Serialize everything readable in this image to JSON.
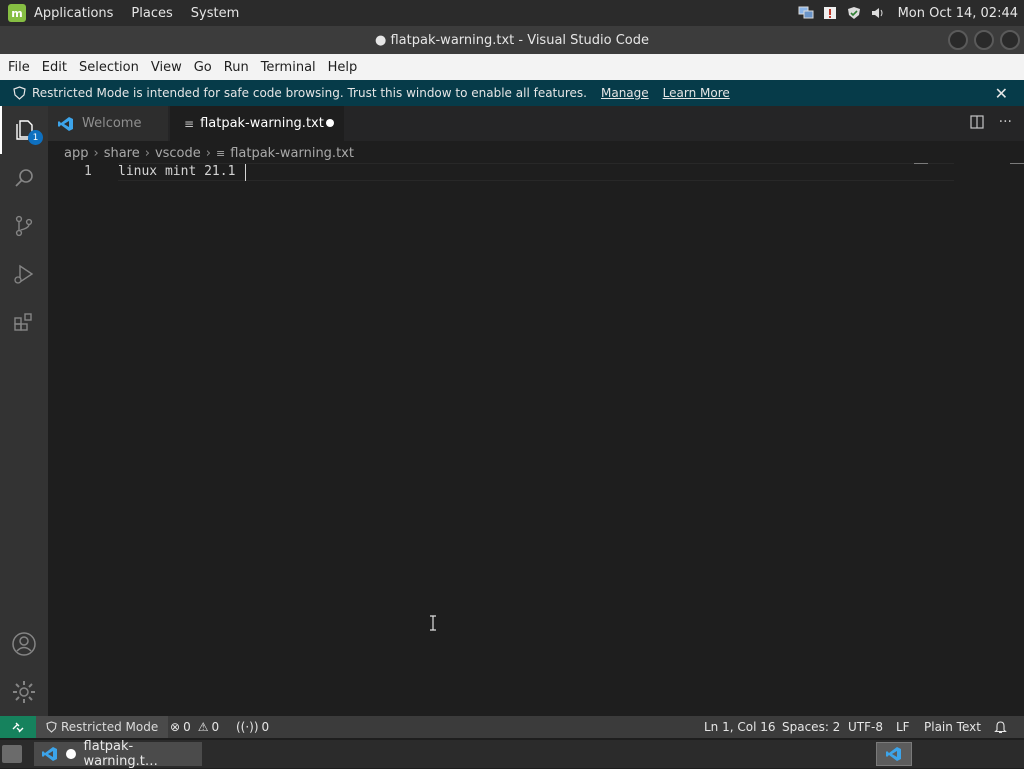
{
  "system_panel": {
    "menus": [
      "Applications",
      "Places",
      "System"
    ],
    "clock": "Mon Oct 14, 02:44",
    "tray_icons": [
      "network-icon",
      "update-icon",
      "shield-icon",
      "volume-icon"
    ]
  },
  "window": {
    "title": "● flatpak-warning.txt - Visual Studio Code"
  },
  "menubar": {
    "items": [
      "File",
      "Edit",
      "Selection",
      "View",
      "Go",
      "Run",
      "Terminal",
      "Help"
    ]
  },
  "banner": {
    "message": "Restricted Mode is intended for safe code browsing. Trust this window to enable all features.",
    "manage_label": "Manage",
    "learn_more_label": "Learn More"
  },
  "activity_bar": {
    "explorer_badge": "1"
  },
  "tabs": [
    {
      "label": "Welcome"
    },
    {
      "label": "flatpak-warning.txt"
    }
  ],
  "breadcrumbs": [
    "app",
    "share",
    "vscode",
    "flatpak-warning.txt"
  ],
  "editor": {
    "line_number": "1",
    "line_text": "linux mint 21.1"
  },
  "statusbar": {
    "restricted_label": "Restricted Mode",
    "errors": "0",
    "warnings": "0",
    "ports": "0",
    "position": "Ln 1, Col 16",
    "spaces": "Spaces: 2",
    "encoding": "UTF-8",
    "eol": "LF",
    "language": "Plain Text"
  },
  "taskbar": {
    "window_label": "flatpak-warning.t…"
  },
  "colors": {
    "banner_bg": "#063b49",
    "remote_bg": "#16825d",
    "badge": "#0e70c0",
    "mint_green": "#86be43"
  }
}
